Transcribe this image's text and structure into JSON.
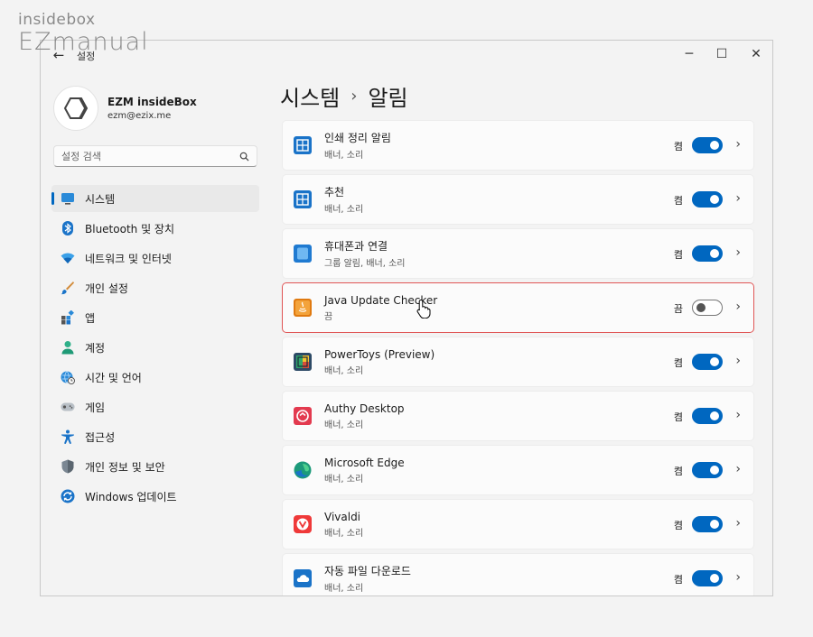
{
  "watermark": {
    "line1": "insidebox",
    "line2": "EZmanual"
  },
  "window": {
    "title": "설정",
    "back": "←",
    "minimize": "─",
    "maximize": "☐",
    "close": "✕"
  },
  "profile": {
    "name": "EZM insideBox",
    "email": "ezm@ezix.me"
  },
  "search": {
    "placeholder": "설정 검색"
  },
  "nav": [
    {
      "label": "시스템",
      "icon": "system-icon",
      "active": true
    },
    {
      "label": "Bluetooth 및 장치",
      "icon": "bluetooth-icon"
    },
    {
      "label": "네트워크 및 인터넷",
      "icon": "wifi-icon"
    },
    {
      "label": "개인 설정",
      "icon": "brush-icon"
    },
    {
      "label": "앱",
      "icon": "apps-icon"
    },
    {
      "label": "계정",
      "icon": "account-icon"
    },
    {
      "label": "시간 및 언어",
      "icon": "globe-clock-icon"
    },
    {
      "label": "게임",
      "icon": "gamepad-icon"
    },
    {
      "label": "접근성",
      "icon": "accessibility-icon"
    },
    {
      "label": "개인 정보 및 보안",
      "icon": "shield-icon"
    },
    {
      "label": "Windows 업데이트",
      "icon": "update-icon"
    }
  ],
  "breadcrumb": {
    "parent": "시스템",
    "separator": "›",
    "current": "알림"
  },
  "apps": [
    {
      "name": "인쇄 정리 알림",
      "sub": "배너, 소리",
      "state": "켬",
      "on": true,
      "icon": "print-queue-icon",
      "color": "#1a73c8"
    },
    {
      "name": "추천",
      "sub": "배너, 소리",
      "state": "켬",
      "on": true,
      "icon": "suggestions-icon",
      "color": "#1a73c8"
    },
    {
      "name": "휴대폰과 연결",
      "sub": "그룹 알림, 배너, 소리",
      "state": "켬",
      "on": true,
      "icon": "phone-link-icon",
      "color": "#1f7ad1"
    },
    {
      "name": "Java Update Checker",
      "sub": "끔",
      "state": "끔",
      "on": false,
      "highlight": true,
      "icon": "java-icon",
      "color": "#e07a10"
    },
    {
      "name": "PowerToys (Preview)",
      "sub": "배너, 소리",
      "state": "켬",
      "on": true,
      "icon": "powertoys-icon",
      "color": "#3b5e7a"
    },
    {
      "name": "Authy Desktop",
      "sub": "배너, 소리",
      "state": "켬",
      "on": true,
      "icon": "authy-icon",
      "color": "#e33a4f"
    },
    {
      "name": "Microsoft Edge",
      "sub": "배너, 소리",
      "state": "켬",
      "on": true,
      "icon": "edge-icon",
      "color": "#1c9a7a"
    },
    {
      "name": "Vivaldi",
      "sub": "배너, 소리",
      "state": "켬",
      "on": true,
      "icon": "vivaldi-icon",
      "color": "#ef3939"
    },
    {
      "name": "자동 파일 다운로드",
      "sub": "배너, 소리",
      "state": "켬",
      "on": true,
      "icon": "cloud-icon",
      "color": "#1a73c8"
    }
  ]
}
